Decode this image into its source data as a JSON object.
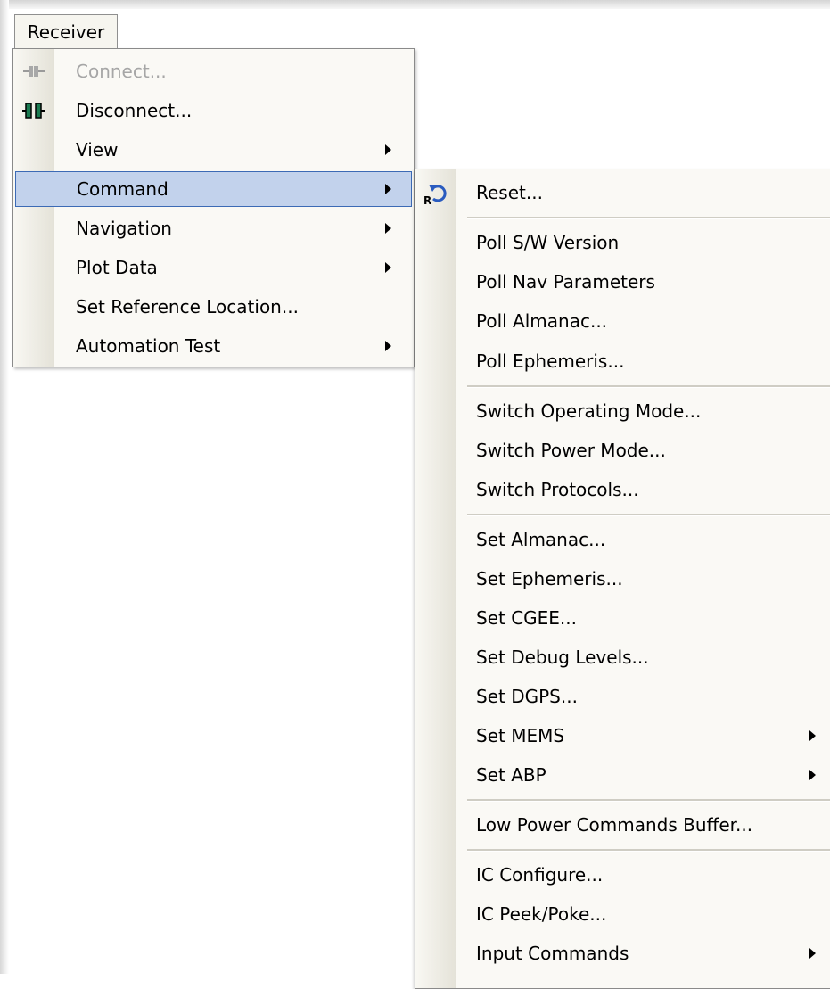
{
  "menubar": {
    "receiver_label": "Receiver"
  },
  "main_menu": {
    "items": [
      {
        "label": "Connect...",
        "icon": "plug-connect-icon",
        "disabled": true
      },
      {
        "label": "Disconnect...",
        "icon": "plug-disconnect-icon"
      },
      {
        "label": "View",
        "submenu": true
      },
      {
        "label": "Command",
        "submenu": true,
        "highlighted": true
      },
      {
        "label": "Navigation",
        "submenu": true
      },
      {
        "label": "Plot Data",
        "submenu": true
      },
      {
        "label": "Set Reference Location..."
      },
      {
        "label": "Automation Test",
        "submenu": true
      }
    ]
  },
  "command_submenu": {
    "items": [
      {
        "label": "Reset...",
        "icon": "reset-icon",
        "icon_letter": "R"
      },
      {
        "label": "Poll S/W Version"
      },
      {
        "label": "Poll Nav Parameters"
      },
      {
        "label": "Poll Almanac..."
      },
      {
        "label": "Poll Ephemeris..."
      },
      {
        "label": "Switch Operating Mode..."
      },
      {
        "label": "Switch Power Mode..."
      },
      {
        "label": "Switch Protocols..."
      },
      {
        "label": "Set Almanac..."
      },
      {
        "label": "Set Ephemeris..."
      },
      {
        "label": "Set CGEE..."
      },
      {
        "label": "Set Debug Levels..."
      },
      {
        "label": "Set DGPS..."
      },
      {
        "label": "Set MEMS",
        "submenu": true
      },
      {
        "label": "Set ABP",
        "submenu": true
      },
      {
        "label": "Low Power Commands Buffer..."
      },
      {
        "label": "IC Configure..."
      },
      {
        "label": "IC Peek/Poke..."
      },
      {
        "label": "Input Commands",
        "submenu": true
      }
    ]
  },
  "colors": {
    "highlight_fill": "#c2d2ec",
    "highlight_border": "#3c6ab5",
    "disabled_text": "#a6a6a6"
  }
}
